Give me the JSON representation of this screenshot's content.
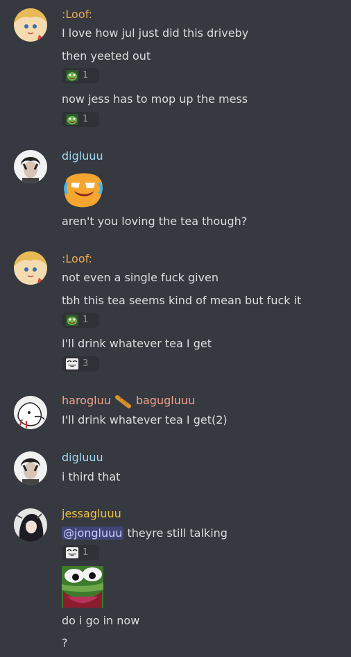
{
  "colors": {
    "background": "#36393f",
    "reaction_bg": "#2f3136",
    "text": "#dcddde",
    "muted": "#8e9297",
    "loof": "#f0a95a",
    "digluuu": "#9fd8f0",
    "harogluu": "#f4a18b",
    "jessagluuu": "#f0c040",
    "mention": "#c9cdfb"
  },
  "messages": [
    {
      "author": ":Loof:",
      "lines": [
        "I love how jul just did this driveby",
        "then yeeted out",
        "now jess has to mop up the mess"
      ],
      "reactions": [
        {
          "icon": "pepe-cheer-emoji",
          "count": "1"
        },
        {
          "icon": "pepe-cheer-emoji",
          "count": "1"
        }
      ]
    },
    {
      "author": "digluuu",
      "lines": [
        "aren't you loving the tea though?"
      ]
    },
    {
      "author": ":Loof:",
      "lines": [
        "not even a single fuck given",
        "tbh this tea seems kind of mean but fuck it",
        "I'll drink whatever tea I get"
      ],
      "reactions": [
        {
          "icon": "pepe-cheer-emoji",
          "count": "1"
        },
        {
          "icon": "troll-face-emoji",
          "count": "3"
        }
      ]
    },
    {
      "author": "harogluu",
      "author2": "bagugluuu",
      "lines": [
        "I'll drink whatever tea I get(2)"
      ]
    },
    {
      "author": "digluuu",
      "lines": [
        "i third that"
      ]
    },
    {
      "author": "jessagluuu",
      "mention": "@jongluuu",
      "lines": [
        " theyre still talking",
        "do i go in now",
        "?"
      ],
      "reactions": [
        {
          "icon": "troll-face-emoji",
          "count": "1"
        }
      ]
    }
  ]
}
